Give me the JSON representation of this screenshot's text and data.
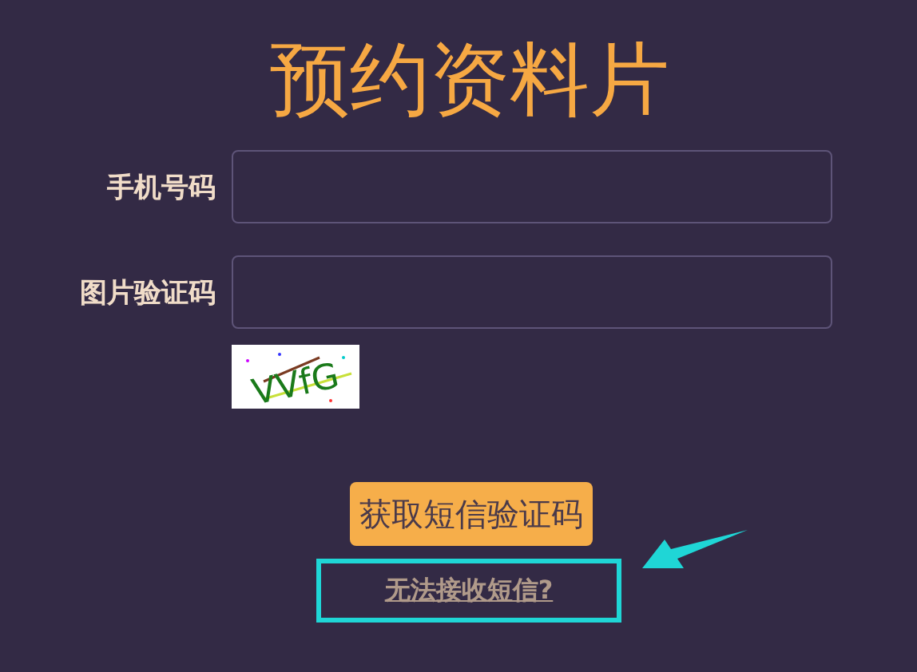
{
  "title": "预约资料片",
  "fields": [
    {
      "label": "手机号码"
    },
    {
      "label": "图片验证码"
    }
  ],
  "captcha": "VVfG",
  "button": "获取短信验证码",
  "link": "无法接收短信?"
}
